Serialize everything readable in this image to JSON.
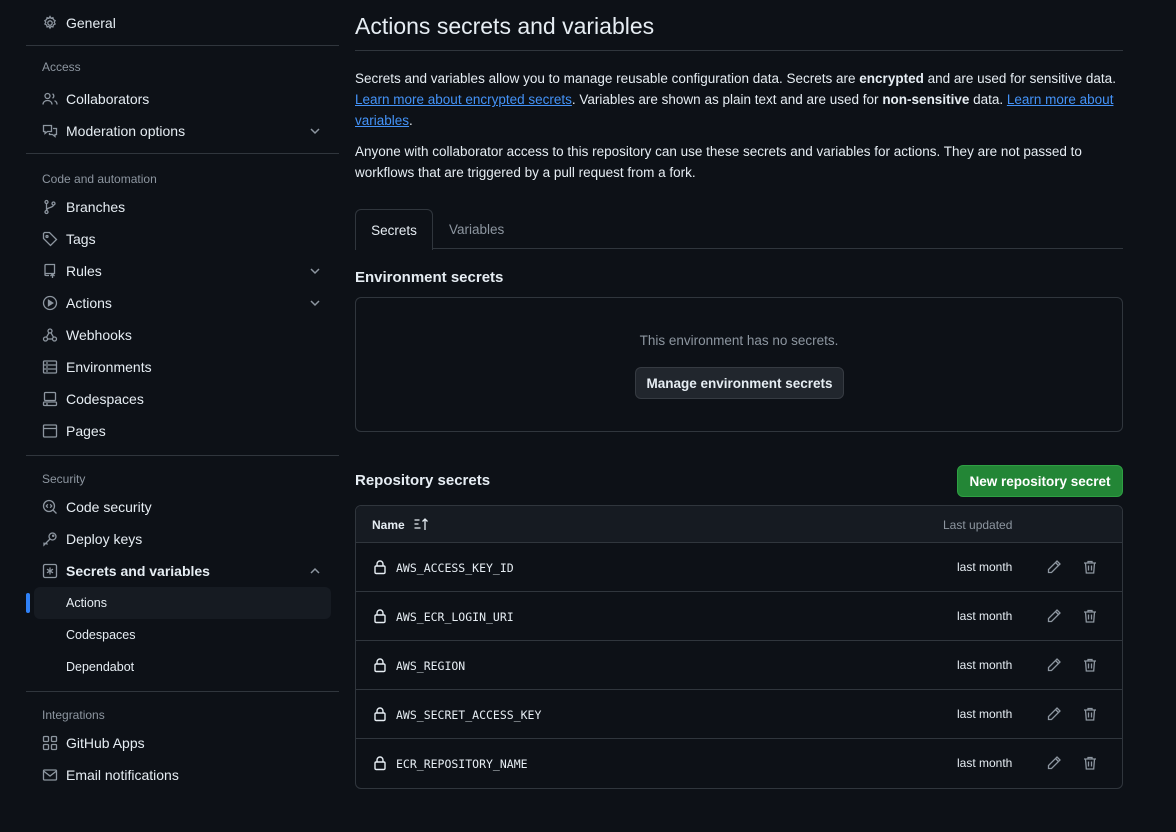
{
  "sidebar": {
    "general": "General",
    "sections": [
      {
        "title": "Access",
        "items": [
          {
            "label": "Collaborators",
            "icon": "people-icon",
            "chevron": false
          },
          {
            "label": "Moderation options",
            "icon": "comment-discussion-icon",
            "chevron": true
          }
        ]
      },
      {
        "title": "Code and automation",
        "items": [
          {
            "label": "Branches",
            "icon": "git-branch-icon",
            "chevron": false
          },
          {
            "label": "Tags",
            "icon": "tag-icon",
            "chevron": false
          },
          {
            "label": "Rules",
            "icon": "repo-push-icon",
            "chevron": true
          },
          {
            "label": "Actions",
            "icon": "play-icon",
            "chevron": true
          },
          {
            "label": "Webhooks",
            "icon": "webhook-icon",
            "chevron": false
          },
          {
            "label": "Environments",
            "icon": "server-icon",
            "chevron": false
          },
          {
            "label": "Codespaces",
            "icon": "codespaces-icon",
            "chevron": false
          },
          {
            "label": "Pages",
            "icon": "browser-icon",
            "chevron": false
          }
        ]
      },
      {
        "title": "Security",
        "items": [
          {
            "label": "Code security",
            "icon": "codescan-icon",
            "chevron": false
          },
          {
            "label": "Deploy keys",
            "icon": "key-icon",
            "chevron": false
          },
          {
            "label": "Secrets and variables",
            "icon": "key-asterisk-icon",
            "chevron": true
          }
        ],
        "subitems": [
          "Actions",
          "Codespaces",
          "Dependabot"
        ]
      },
      {
        "title": "Integrations",
        "items": [
          {
            "label": "GitHub Apps",
            "icon": "apps-icon",
            "chevron": false
          },
          {
            "label": "Email notifications",
            "icon": "mail-icon",
            "chevron": false
          }
        ]
      }
    ]
  },
  "main": {
    "title": "Actions secrets and variables",
    "intro": {
      "p1_a": "Secrets and variables allow you to manage reusable configuration data. Secrets are ",
      "p1_b": "encrypted",
      "p1_c": " and are used for sensitive data. ",
      "p1_link1": "Learn more about encrypted secrets",
      "p1_d": ". Variables are shown as plain text and are used for ",
      "p1_e": "non-sensitive",
      "p1_f": " data. ",
      "p1_link2": "Learn more about variables",
      "p1_g": ".",
      "p2": "Anyone with collaborator access to this repository can use these secrets and variables for actions. They are not passed to workflows that are triggered by a pull request from a fork."
    },
    "tabs": {
      "secrets": "Secrets",
      "variables": "Variables"
    },
    "env": {
      "heading": "Environment secrets",
      "empty": "This environment has no secrets.",
      "button": "Manage environment secrets"
    },
    "repo": {
      "heading": "Repository secrets",
      "new_button": "New repository secret",
      "col_name": "Name",
      "col_updated": "Last updated",
      "rows": [
        {
          "name": "AWS_ACCESS_KEY_ID",
          "updated": "last month"
        },
        {
          "name": "AWS_ECR_LOGIN_URI",
          "updated": "last month"
        },
        {
          "name": "AWS_REGION",
          "updated": "last month"
        },
        {
          "name": "AWS_SECRET_ACCESS_KEY",
          "updated": "last month"
        },
        {
          "name": "ECR_REPOSITORY_NAME",
          "updated": "last month"
        }
      ]
    }
  },
  "colors": {
    "bg": "#0d1117",
    "link": "#4493f8",
    "primary": "#238636",
    "muted": "#8d96a0",
    "border": "#30363d"
  }
}
